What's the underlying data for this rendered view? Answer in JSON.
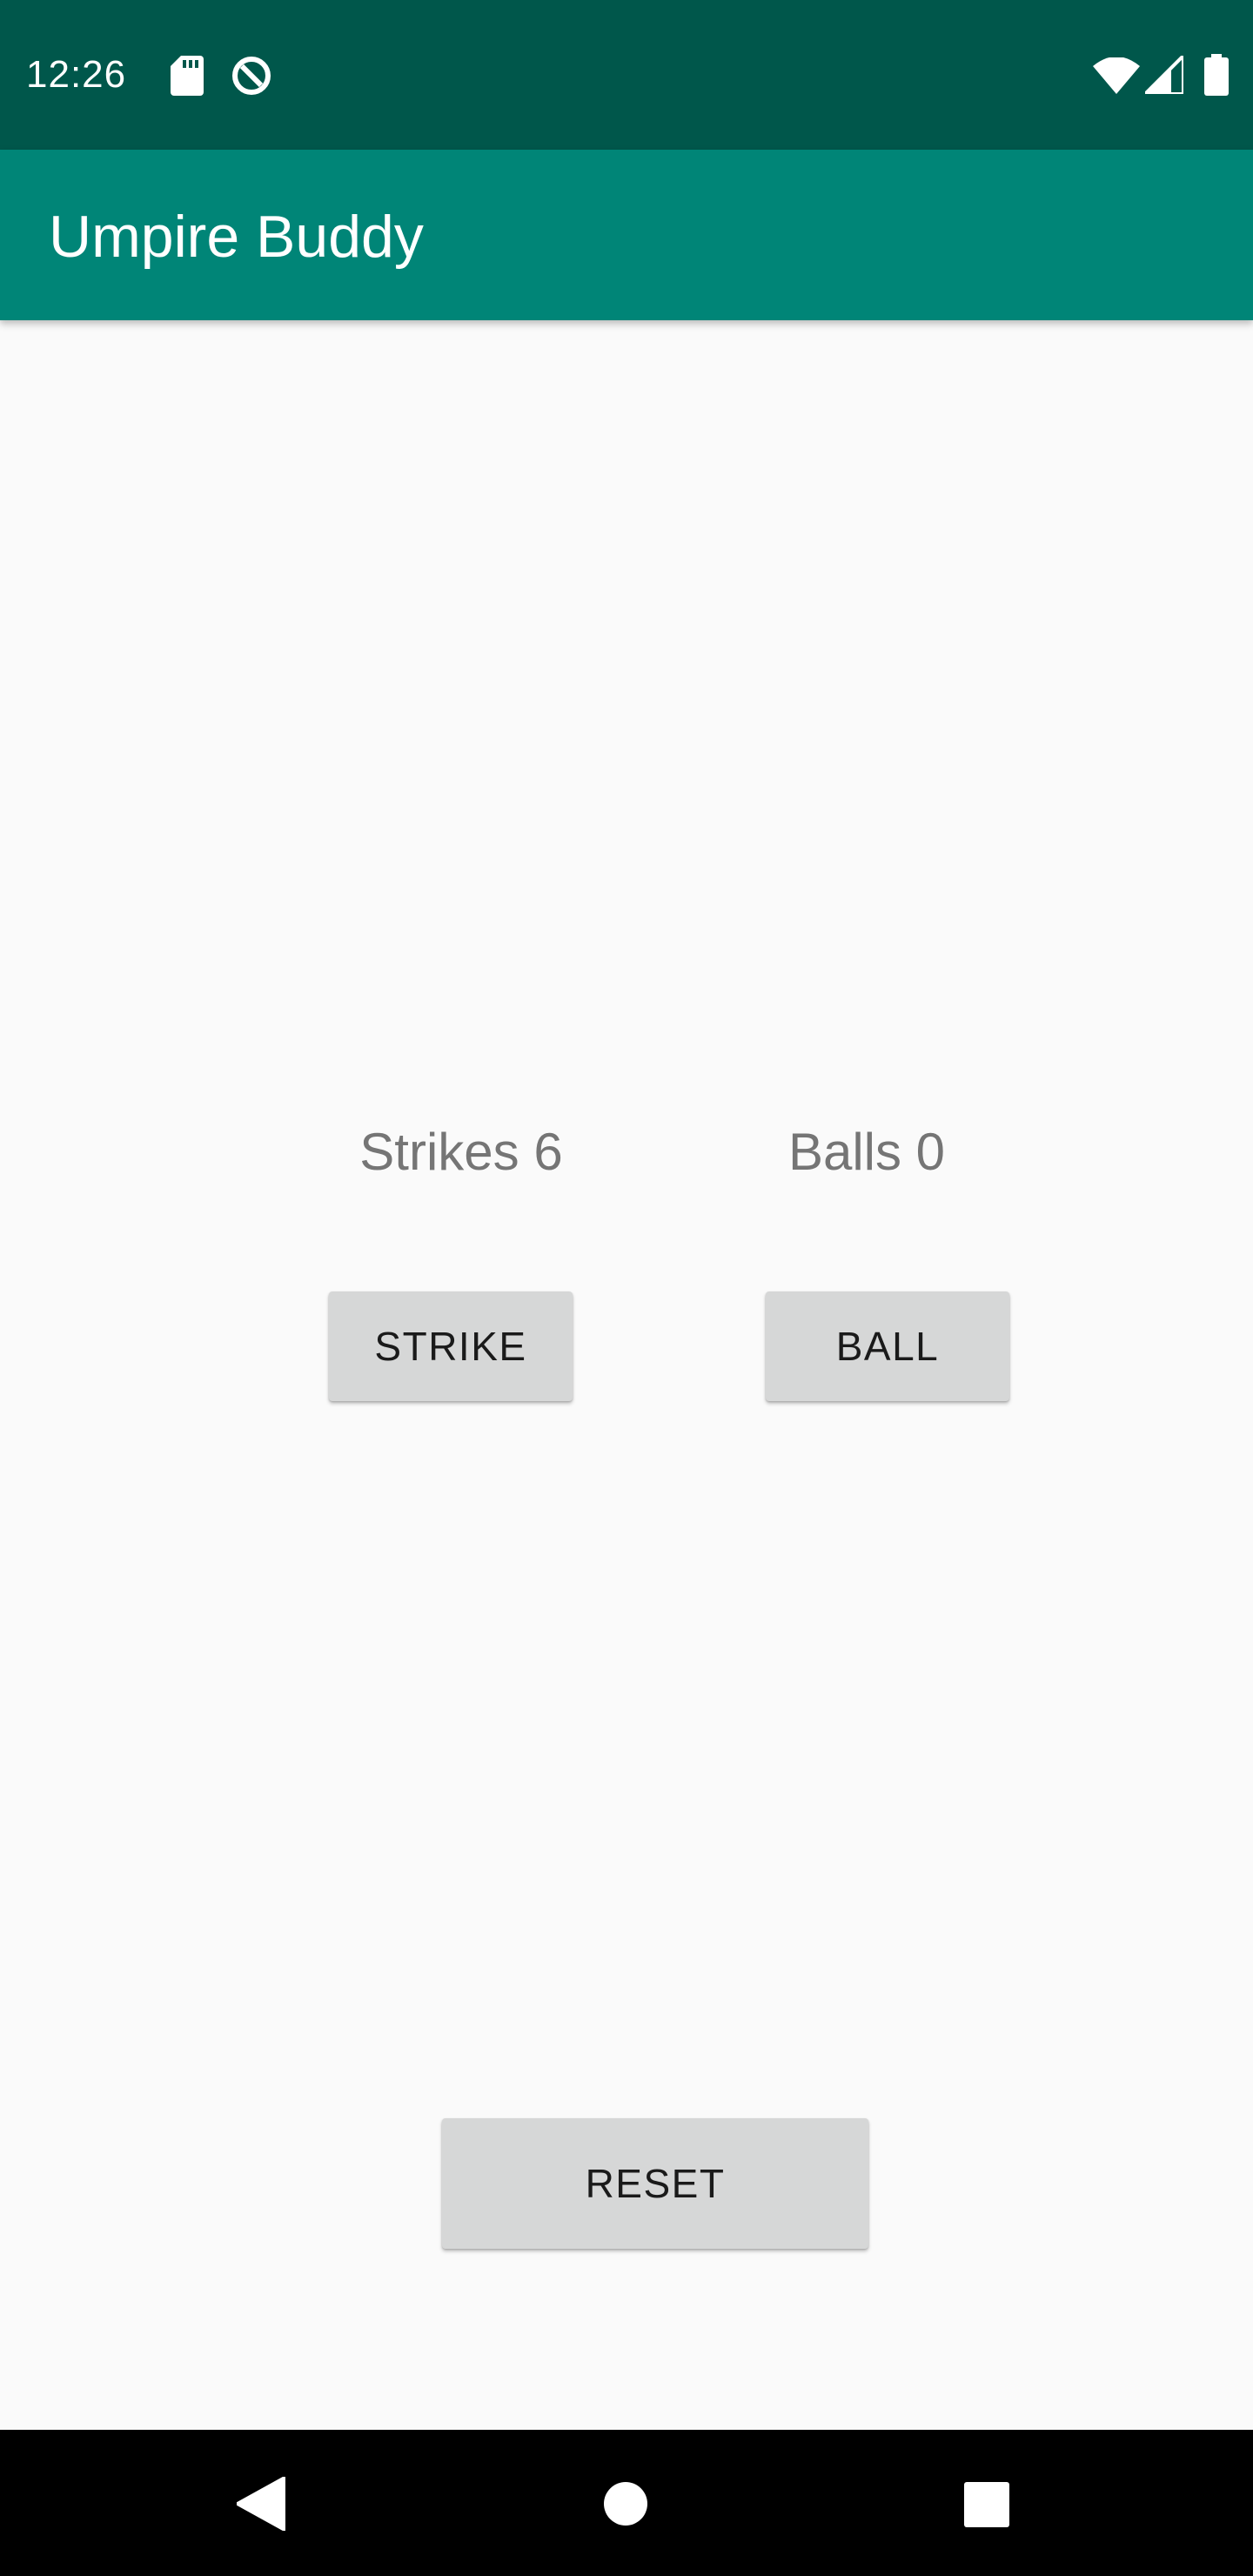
{
  "status_bar": {
    "time": "12:26",
    "icons": [
      "sd-card-icon",
      "data-saver-icon",
      "wifi-icon",
      "signal-icon",
      "battery-icon"
    ],
    "background": "#00574b"
  },
  "app_bar": {
    "title": "Umpire Buddy",
    "background": "#008577"
  },
  "counters": {
    "strikes": "Strikes 6",
    "balls": "Balls 0"
  },
  "buttons": {
    "strike_label": "STRIKE",
    "ball_label": "BALL",
    "reset_label": "RESET"
  },
  "nav_bar": {
    "icons": [
      "back-icon",
      "home-icon",
      "recents-icon"
    ]
  }
}
